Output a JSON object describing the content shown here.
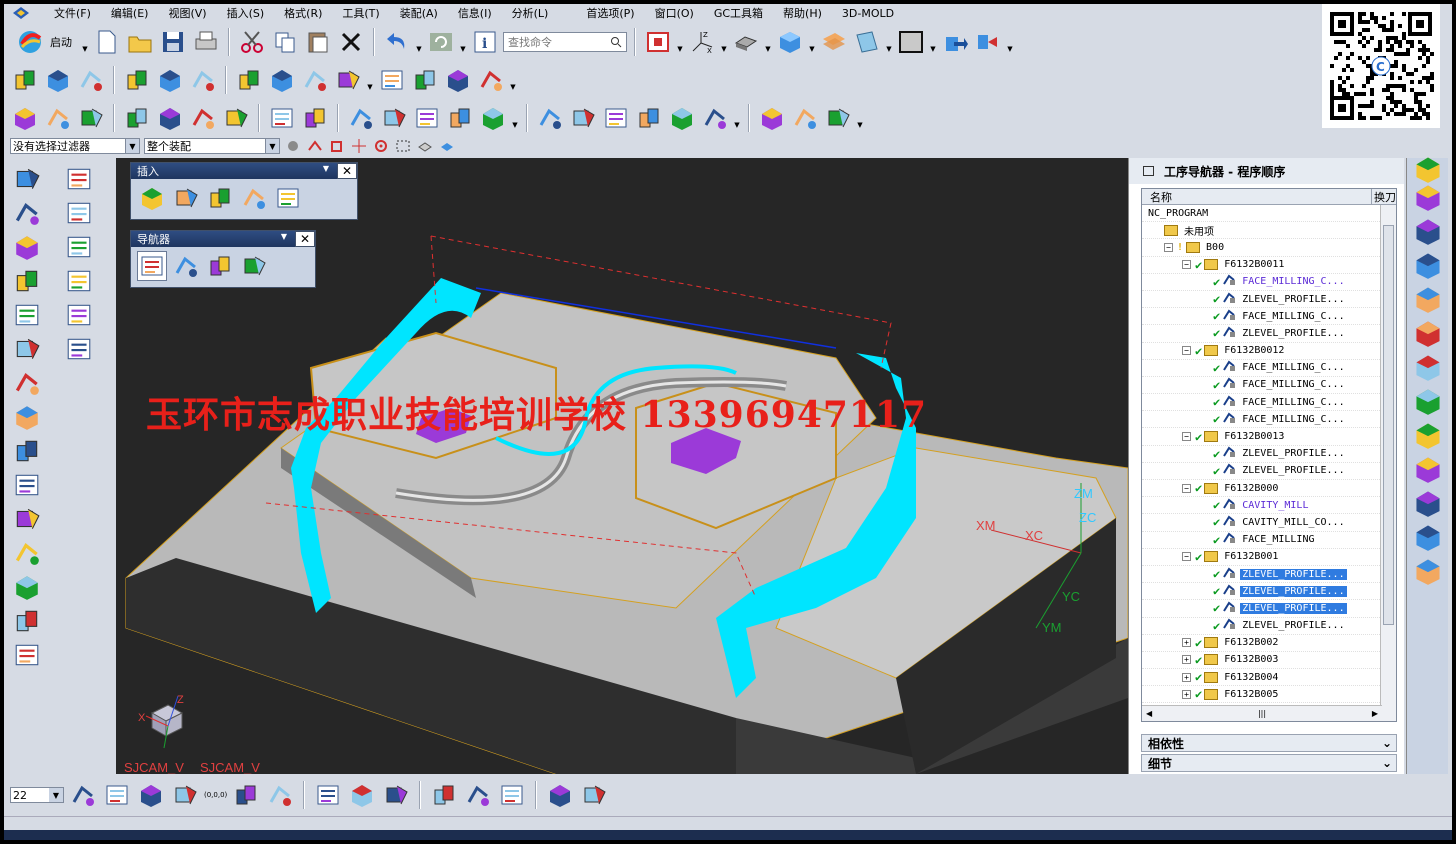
{
  "menu": [
    "文件(F)",
    "编辑(E)",
    "视图(V)",
    "插入(S)",
    "格式(R)",
    "工具(T)",
    "装配(A)",
    "信息(I)",
    "分析(L)",
    "首选项(P)",
    "窗口(O)",
    "GC工具箱",
    "帮助(H)",
    "3D-MOLD"
  ],
  "toolbar": {
    "start_label": "启动",
    "search_placeholder": "查找命令"
  },
  "selection_bar": {
    "filter": "没有选择过滤器",
    "scope": "整个装配"
  },
  "palettes": {
    "insert_title": "插入",
    "navigator_title": "导航器"
  },
  "viewport": {
    "watermark": "玉环市志成职业技能培训学校  13396947117",
    "view_label_left": "SJCAM_V",
    "view_label_right": "SJCAM_V",
    "axis_labels": {
      "zm": "ZM",
      "zc": "ZC",
      "xm": "XM",
      "xc": "XC",
      "yc": "YC",
      "ym": "YM",
      "triad_x": "X",
      "triad_z": "Z"
    }
  },
  "navigator": {
    "title": "工序导航器 - 程序顺序",
    "col_name": "名称",
    "col_change": "换刀",
    "rows": [
      {
        "indent": 0,
        "label": "NC_PROGRAM",
        "type": "root"
      },
      {
        "indent": 1,
        "label": "未用项",
        "type": "folder"
      },
      {
        "indent": 1,
        "label": "B00",
        "type": "group",
        "expander": "−"
      },
      {
        "indent": 2,
        "label": "F6132B0011",
        "type": "program",
        "expander": "−"
      },
      {
        "indent": 3,
        "label": "FACE_MILLING_C...",
        "type": "op",
        "style": "purple"
      },
      {
        "indent": 3,
        "label": "ZLEVEL_PROFILE...",
        "type": "op"
      },
      {
        "indent": 3,
        "label": "FACE_MILLING_C...",
        "type": "op"
      },
      {
        "indent": 3,
        "label": "ZLEVEL_PROFILE...",
        "type": "op"
      },
      {
        "indent": 2,
        "label": "F6132B0012",
        "type": "program",
        "expander": "−"
      },
      {
        "indent": 3,
        "label": "FACE_MILLING_C...",
        "type": "op"
      },
      {
        "indent": 3,
        "label": "FACE_MILLING_C...",
        "type": "op"
      },
      {
        "indent": 3,
        "label": "FACE_MILLING_C...",
        "type": "op"
      },
      {
        "indent": 3,
        "label": "FACE_MILLING_C...",
        "type": "op"
      },
      {
        "indent": 2,
        "label": "F6132B0013",
        "type": "program",
        "expander": "−"
      },
      {
        "indent": 3,
        "label": "ZLEVEL_PROFILE...",
        "type": "op"
      },
      {
        "indent": 3,
        "label": "ZLEVEL_PROFILE...",
        "type": "op"
      },
      {
        "indent": 2,
        "label": "F6132B000",
        "type": "program",
        "expander": "−"
      },
      {
        "indent": 3,
        "label": "CAVITY_MILL",
        "type": "op",
        "style": "purple"
      },
      {
        "indent": 3,
        "label": "CAVITY_MILL_CO...",
        "type": "op"
      },
      {
        "indent": 3,
        "label": "FACE_MILLING",
        "type": "op"
      },
      {
        "indent": 2,
        "label": "F6132B001",
        "type": "program",
        "expander": "−"
      },
      {
        "indent": 3,
        "label": "ZLEVEL_PROFILE...",
        "type": "op",
        "style": "sel"
      },
      {
        "indent": 3,
        "label": "ZLEVEL_PROFILE...",
        "type": "op",
        "style": "sel"
      },
      {
        "indent": 3,
        "label": "ZLEVEL_PROFILE...",
        "type": "op",
        "style": "sel"
      },
      {
        "indent": 3,
        "label": "ZLEVEL_PROFILE...",
        "type": "op"
      },
      {
        "indent": 2,
        "label": "F6132B002",
        "type": "program",
        "expander": "+"
      },
      {
        "indent": 2,
        "label": "F6132B003",
        "type": "program",
        "expander": "+"
      },
      {
        "indent": 2,
        "label": "F6132B004",
        "type": "program",
        "expander": "+"
      },
      {
        "indent": 2,
        "label": "F6132B005",
        "type": "program",
        "expander": "+"
      }
    ],
    "accordion": [
      "相依性",
      "细节"
    ]
  },
  "bottom_toolbar": {
    "zoom_value": "22",
    "origin_label": "(0,0,0)"
  },
  "colors": {
    "toolpath_cyan": "#00e5ff",
    "model_gray": "#b9b9b9",
    "watermark_red": "#e8201a",
    "selection_blue": "#2f7be0"
  }
}
